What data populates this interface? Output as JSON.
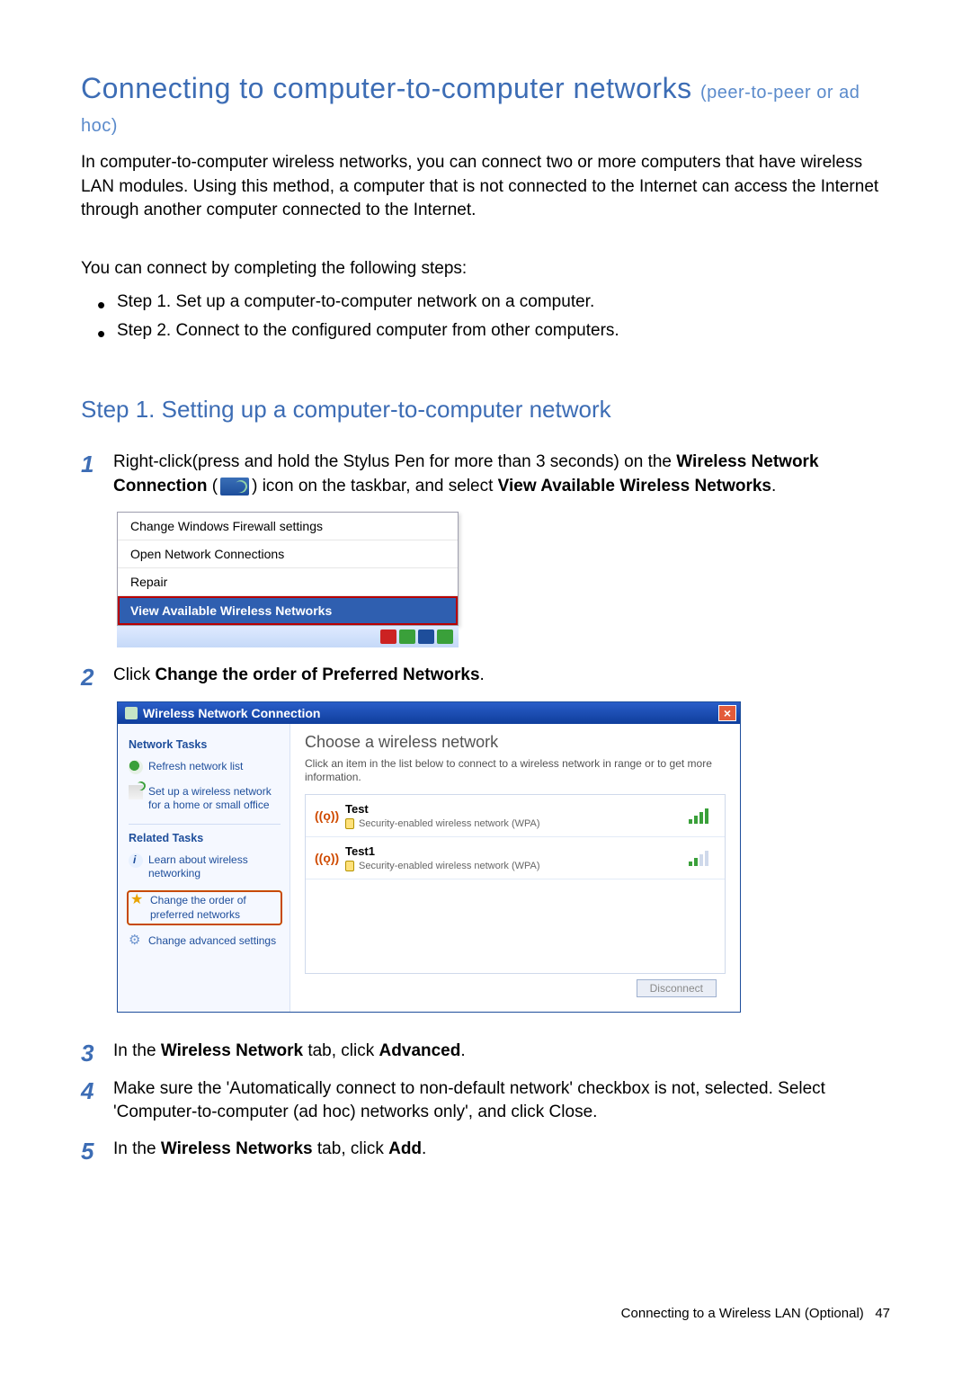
{
  "title_main": "Connecting to computer-to-computer networks",
  "title_sub": "(peer-to-peer or ad hoc)",
  "intro": "In computer-to-computer wireless networks, you can connect two or more computers that have wireless LAN modules. Using this method, a computer that is not connected to the Internet can access the Internet through another computer connected to the Internet.",
  "steps_intro": "You can connect by completing the following steps:",
  "overview": [
    "Step 1. Set up a computer-to-computer network on a computer.",
    "Step 2. Connect to the configured computer from other computers."
  ],
  "section_title": "Step 1. Setting up a computer-to-computer network",
  "steps": {
    "s1_pre": "Right-click(press and hold the Stylus Pen for more than 3 seconds) on the ",
    "s1_boldA": "Wireless Network Connection",
    "s1_mid": " (",
    "s1_mid2": ") icon on the taskbar, and select ",
    "s1_boldB": "View Available Wireless Networks",
    "s1_end": ".",
    "s2_pre": "Click ",
    "s2_bold": "Change the order of Preferred Networks",
    "s2_end": ".",
    "s3_pre": "In the ",
    "s3_boldA": "Wireless Network",
    "s3_mid": " tab, click ",
    "s3_boldB": "Advanced",
    "s3_end": ".",
    "s4": "Make sure the 'Automatically connect to non-default network' checkbox is not, selected. Select 'Computer-to-computer (ad hoc) networks only', and click Close.",
    "s5_pre": "In the ",
    "s5_boldA": "Wireless Networks",
    "s5_mid": " tab, click ",
    "s5_boldB": "Add",
    "s5_end": "."
  },
  "ctxmenu": {
    "items": [
      "Change Windows Firewall settings",
      "Open Network Connections",
      "Repair"
    ],
    "highlight": "View Available Wireless Networks"
  },
  "wlan": {
    "title": "Wireless Network Connection",
    "side": {
      "hdr1": "Network Tasks",
      "refresh": "Refresh network list",
      "setup": "Set up a wireless network for a home or small office",
      "hdr2": "Related Tasks",
      "learn": "Learn about wireless networking",
      "order": "Change the order of preferred networks",
      "advanced": "Change advanced settings"
    },
    "main": {
      "heading": "Choose a wireless network",
      "sub": "Click an item in the list below to connect to a wireless network in range or to get more information.",
      "networks": [
        {
          "name": "Test",
          "detail": "Security-enabled wireless network (WPA)",
          "strength": "strong"
        },
        {
          "name": "Test1",
          "detail": "Security-enabled wireless network (WPA)",
          "strength": "weak"
        }
      ],
      "button": "Disconnect"
    }
  },
  "footer": {
    "label": "Connecting to a Wireless LAN (Optional)",
    "page": "47"
  }
}
